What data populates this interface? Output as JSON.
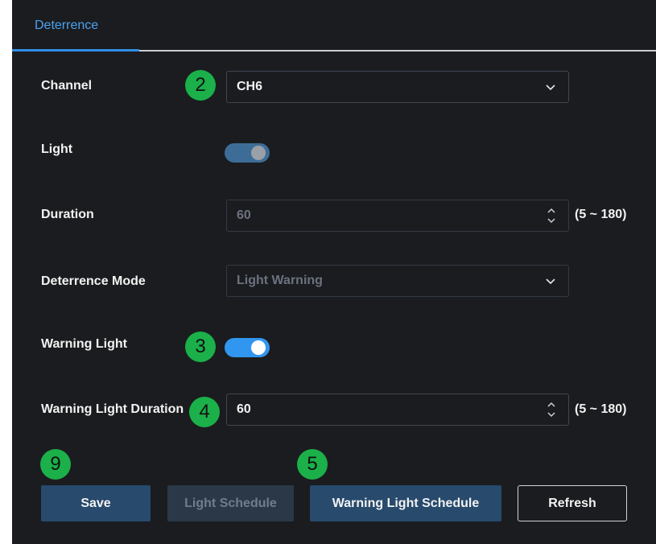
{
  "tabs": [
    {
      "label": "Deterrence",
      "active": true
    }
  ],
  "form": {
    "channel": {
      "label": "Channel",
      "value": "CH6"
    },
    "light": {
      "label": "Light",
      "state": "off"
    },
    "duration": {
      "label": "Duration",
      "value": "60",
      "range": "(5 ~ 180)"
    },
    "deterrence_mode": {
      "label": "Deterrence Mode",
      "value": "Light Warning"
    },
    "warning_light": {
      "label": "Warning Light",
      "state": "on"
    },
    "warning_light_duration": {
      "label": "Warning Light Duration",
      "value": "60",
      "range": "(5 ~ 180)"
    }
  },
  "buttons": {
    "save": "Save",
    "light_schedule": "Light Schedule",
    "warning_light_schedule": "Warning Light Schedule",
    "refresh": "Refresh"
  },
  "badges": {
    "channel": "2",
    "warning_light": "3",
    "warning_light_duration": "4",
    "warning_light_schedule": "5",
    "save": "9"
  },
  "colors": {
    "accent": "#3196f0",
    "badge": "#1bb04a",
    "background": "#1b1c1f"
  },
  "icons": [
    "chevron-down-icon",
    "spinner-up-down-icon"
  ]
}
